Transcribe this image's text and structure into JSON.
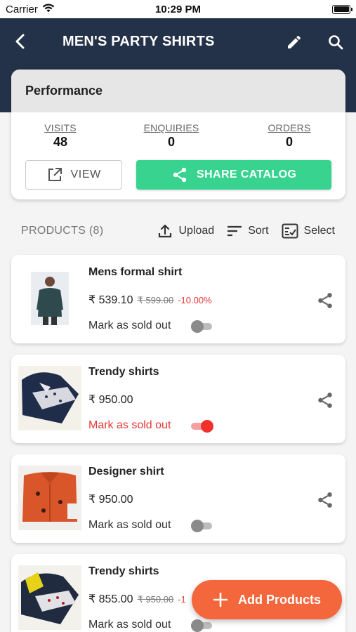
{
  "status_bar": {
    "carrier": "Carrier",
    "time": "10:29 PM"
  },
  "header": {
    "title": "MEN'S PARTY SHIRTS",
    "back_icon": "chevron-left-icon",
    "edit_icon": "pencil-icon",
    "search_icon": "search-icon"
  },
  "performance": {
    "title": "Performance",
    "stats": [
      {
        "label": "VISITS",
        "value": "48"
      },
      {
        "label": "ENQUIRIES",
        "value": "0"
      },
      {
        "label": "ORDERS",
        "value": "0"
      }
    ],
    "view_label": "VIEW",
    "share_label": "SHARE CATALOG"
  },
  "products_bar": {
    "count": "PRODUCTS (8)",
    "upload": "Upload",
    "sort": "Sort",
    "select": "Select"
  },
  "products": [
    {
      "name": "Mens formal shirt",
      "price": "₹ 539.10",
      "original_price": "₹ 599.00",
      "discount": "-10.00%",
      "sold_label": "Mark as sold out",
      "sold_out": false
    },
    {
      "name": "Trendy shirts",
      "price": "₹ 950.00",
      "original_price": "",
      "discount": "",
      "sold_label": "Mark as sold out",
      "sold_out": true
    },
    {
      "name": "Designer shirt",
      "price": "₹ 950.00",
      "original_price": "",
      "discount": "",
      "sold_label": "Mark as sold out",
      "sold_out": false
    },
    {
      "name": "Trendy shirts",
      "price": "₹ 855.00",
      "original_price": "₹ 950.00",
      "discount": "-1",
      "sold_label": "Mark as sold out",
      "sold_out": false
    }
  ],
  "fab": {
    "label": "Add Products"
  },
  "colors": {
    "header": "#233249",
    "accent_green": "#37d38f",
    "fab": "#f4663c",
    "red": "#e53935"
  }
}
